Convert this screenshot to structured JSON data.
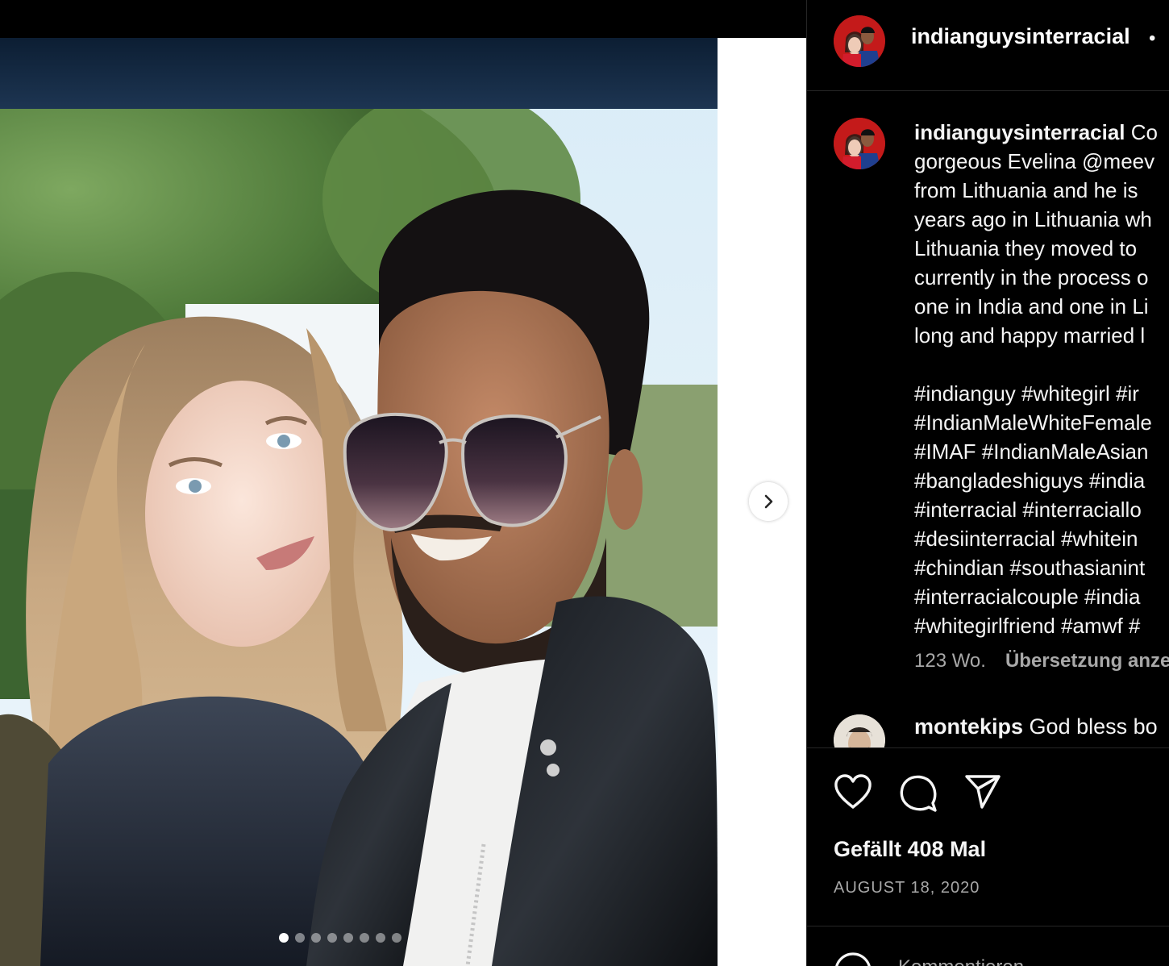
{
  "post": {
    "username": "indianguysinterracial",
    "header_separator": "•",
    "caption_lines": [
      "Co",
      "gorgeous Evelina @meev",
      "from Lithuania and he is",
      "years ago in Lithuania wh",
      "Lithuania they moved to",
      "currently in the process o",
      "one in India and one in Li",
      "long and happy married l"
    ],
    "hashtag_lines": [
      "#indianguy #whitegirl #ir",
      "#IndianMaleWhiteFemale",
      "#IMAF #IndianMaleAsian",
      "#bangladeshiguys #india",
      "#interracial #interraciallo",
      "#desiinterracial #whitein",
      "#chindian #southasianint",
      "#interracialcouple #india",
      "#whitegirlfriend #amwf #"
    ],
    "age": "123 Wo.",
    "translate_label": "Übersetzung anze",
    "comment": {
      "username": "montekips",
      "text": "God bless bo"
    },
    "likes": "Gefällt 408 Mal",
    "date": "AUGUST 18, 2020",
    "comment_placeholder": "Kommentieren ..."
  },
  "carousel": {
    "slide_count": 8,
    "active_index": 0
  },
  "icons": {
    "like": "heart-icon",
    "comment": "comment-bubble-icon",
    "share": "paper-plane-icon",
    "next": "chevron-right-icon",
    "emoji": "smiley-icon"
  }
}
